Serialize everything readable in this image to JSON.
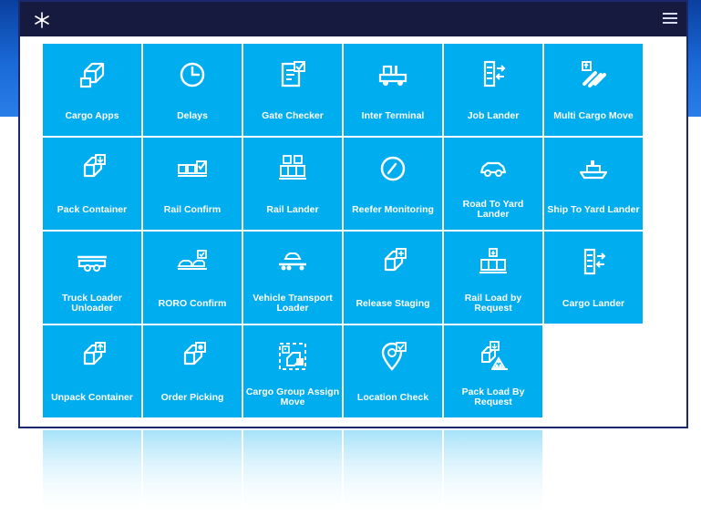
{
  "app": {
    "logo_icon": "snowflake-logo-icon",
    "menu_icon": "hamburger-menu-icon"
  },
  "tiles": [
    {
      "label": "Cargo Apps",
      "icon": "cube-icon"
    },
    {
      "label": "Delays",
      "icon": "clock-icon"
    },
    {
      "label": "Gate Checker",
      "icon": "checklist-icon"
    },
    {
      "label": "Inter Terminal",
      "icon": "truck-icon"
    },
    {
      "label": "Job Lander",
      "icon": "crane-transfer-icon"
    },
    {
      "label": "Multi Cargo Move",
      "icon": "multi-pipe-icon"
    },
    {
      "label": "Pack Container",
      "icon": "pack-cube-icon"
    },
    {
      "label": "Rail Confirm",
      "icon": "rail-check-icon"
    },
    {
      "label": "Rail Lander",
      "icon": "rail-lander-icon"
    },
    {
      "label": "Reefer Monitoring",
      "icon": "gauge-icon"
    },
    {
      "label": "Road To Yard Lander",
      "icon": "car-icon"
    },
    {
      "label": "Ship To Yard Lander",
      "icon": "ship-icon"
    },
    {
      "label": "Truck Loader Unloader",
      "icon": "trailer-icon"
    },
    {
      "label": "RORO Confirm",
      "icon": "roro-icon"
    },
    {
      "label": "Vehicle Transport Loader",
      "icon": "car-transporter-icon"
    },
    {
      "label": "Release Staging",
      "icon": "release-cube-icon"
    },
    {
      "label": "Rail Load by Request",
      "icon": "rail-load-icon"
    },
    {
      "label": "Cargo Lander",
      "icon": "crane-transfer-icon"
    },
    {
      "label": "Unpack Container",
      "icon": "unpack-cube-icon"
    },
    {
      "label": "Order Picking",
      "icon": "pick-cube-icon"
    },
    {
      "label": "Cargo Group Assign Move",
      "icon": "group-select-icon"
    },
    {
      "label": "Location Check",
      "icon": "location-check-icon"
    },
    {
      "label": "Pack Load By Request",
      "icon": "pack-load-icon"
    }
  ],
  "colors": {
    "tile": "#00adef",
    "topbar": "#161a3e",
    "window_border": "#1b2a6e",
    "background_gradient_top": "#0a3f9e"
  }
}
